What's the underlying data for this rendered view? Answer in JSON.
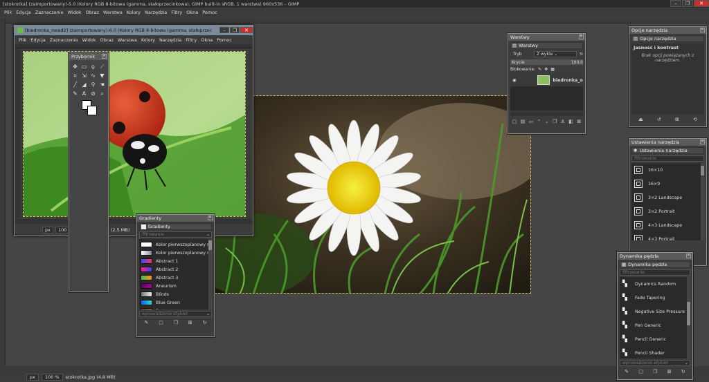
{
  "main_window": {
    "title": "[stokrotka] (zaimportowany)-5.0 (Kolory RGB 8-bitowa (gamma, stałoprzecinkowa), GIMP built-in sRGB, 1 warstwa) 960x536 – GIMP",
    "menu": [
      "Plik",
      "Edycja",
      "Zaznaczenie",
      "Widok",
      "Obraz",
      "Warstwa",
      "Kolory",
      "Narzędzia",
      "Filtry",
      "Okna",
      "Pomoc"
    ],
    "status": {
      "unit": "px",
      "zoom": "100 %",
      "file": "stokrotka.jpg (4,8 MB)"
    }
  },
  "image_window": {
    "title": "[biedronka_owad2] (zaimportowany)-6.0 (Kolory RGB 8-bitowa (gamma, stałoprzecinkowa), GI...",
    "menu": [
      "Plik",
      "Edycja",
      "Zaznaczenie",
      "Widok",
      "Obraz",
      "Warstwa",
      "Kolory",
      "Narzędzia",
      "Filtry",
      "Okna",
      "Pomoc"
    ],
    "status": {
      "unit": "px",
      "zoom": "100",
      "file": "d2.jpg (2,5 MB)"
    }
  },
  "toolbox": {
    "title": "Przybornik"
  },
  "gradients": {
    "title": "Gradienty",
    "tab": "Gradienty",
    "filter": "filtrowanie",
    "tags_placeholder": "wprowadzenie etykiet",
    "items": [
      {
        "name": "Kolor pierwszoplanowy n",
        "c1": "#ffffff",
        "c2": "#ffffff"
      },
      {
        "name": "Kolor pierwszoplanowy n",
        "c1": "#ffffff",
        "c2": "#8a8aa0"
      },
      {
        "name": "Abstract 1",
        "c1": "#3050ff",
        "c2": "#ff3060"
      },
      {
        "name": "Abstract 2",
        "c1": "#ff2080",
        "c2": "#4040ff"
      },
      {
        "name": "Abstract 3",
        "c1": "#40c040",
        "c2": "#ff9020"
      },
      {
        "name": "Aneurism",
        "c1": "#600060",
        "c2": "#a000a0"
      },
      {
        "name": "Blinds",
        "c1": "#777777",
        "c2": "#eeeeee"
      },
      {
        "name": "Blue Green",
        "c1": "#1060ff",
        "c2": "#20e0c0"
      },
      {
        "name": "Browns",
        "c1": "#8a4a20",
        "c2": "#d08040"
      }
    ]
  },
  "layers": {
    "title": "Warstwy",
    "tab": "Warstwy",
    "mode_label": "Tryb",
    "mode_value": "Z wykle",
    "opacity_label": "Krycie",
    "opacity_value": "100,0",
    "lock_label": "Blokowanie:",
    "layer_name": "biedronka_o"
  },
  "tool_options": {
    "title": "Opcje narzędzia",
    "tab": "Opcje narzędzia",
    "tool_name": "Jasność i kontrast",
    "message": "Brak opcji powiązanych z narzędziem."
  },
  "tool_presets": {
    "title": "Ustawienia narzędzia",
    "tab": "Ustawienia narzędzia",
    "filter": "filtrowanie",
    "items": [
      "16×10",
      "16×9",
      "3×2 Landscape",
      "3×2 Portrait",
      "4×3 Landscape",
      "4×3 Portrait"
    ]
  },
  "dynamics": {
    "title": "Dynamika pędzla",
    "tab": "Dynamika pędzla",
    "filter": "filtrowanie",
    "tags_placeholder": "wprowadzenie etykiet",
    "items": [
      "Dynamics Random",
      "Fade Tapering",
      "Negative Size Pressure",
      "Pen Generic",
      "Pencil Generic",
      "Pencil Shader"
    ]
  }
}
